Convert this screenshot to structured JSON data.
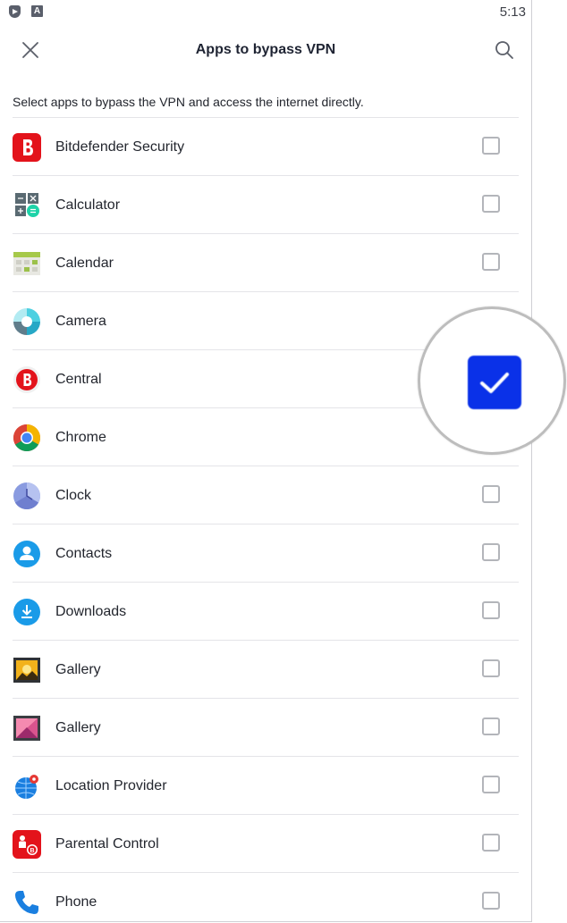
{
  "status_bar": {
    "time": "5:13"
  },
  "header": {
    "title": "Apps to bypass VPN"
  },
  "description": "Select apps to bypass the VPN and access the internet directly.",
  "apps": [
    {
      "name": "Bitdefender Security",
      "icon": "bitdefender-icon",
      "checked": false
    },
    {
      "name": "Calculator",
      "icon": "calculator-icon",
      "checked": false
    },
    {
      "name": "Calendar",
      "icon": "calendar-icon",
      "checked": false
    },
    {
      "name": "Camera",
      "icon": "camera-icon",
      "checked": false
    },
    {
      "name": "Central",
      "icon": "central-icon",
      "checked": true
    },
    {
      "name": "Chrome",
      "icon": "chrome-icon",
      "checked": false
    },
    {
      "name": "Clock",
      "icon": "clock-icon",
      "checked": false
    },
    {
      "name": "Contacts",
      "icon": "contacts-icon",
      "checked": false
    },
    {
      "name": "Downloads",
      "icon": "downloads-icon",
      "checked": false
    },
    {
      "name": "Gallery",
      "icon": "gallery-icon",
      "checked": false
    },
    {
      "name": "Gallery",
      "icon": "gallery-alt-icon",
      "checked": false
    },
    {
      "name": "Location Provider",
      "icon": "location-provider-icon",
      "checked": false
    },
    {
      "name": "Parental Control",
      "icon": "parental-control-icon",
      "checked": false
    },
    {
      "name": "Phone",
      "icon": "phone-icon",
      "checked": false
    }
  ],
  "colors": {
    "accent": "#0a31e8",
    "bitdefender_red": "#e3131b"
  }
}
